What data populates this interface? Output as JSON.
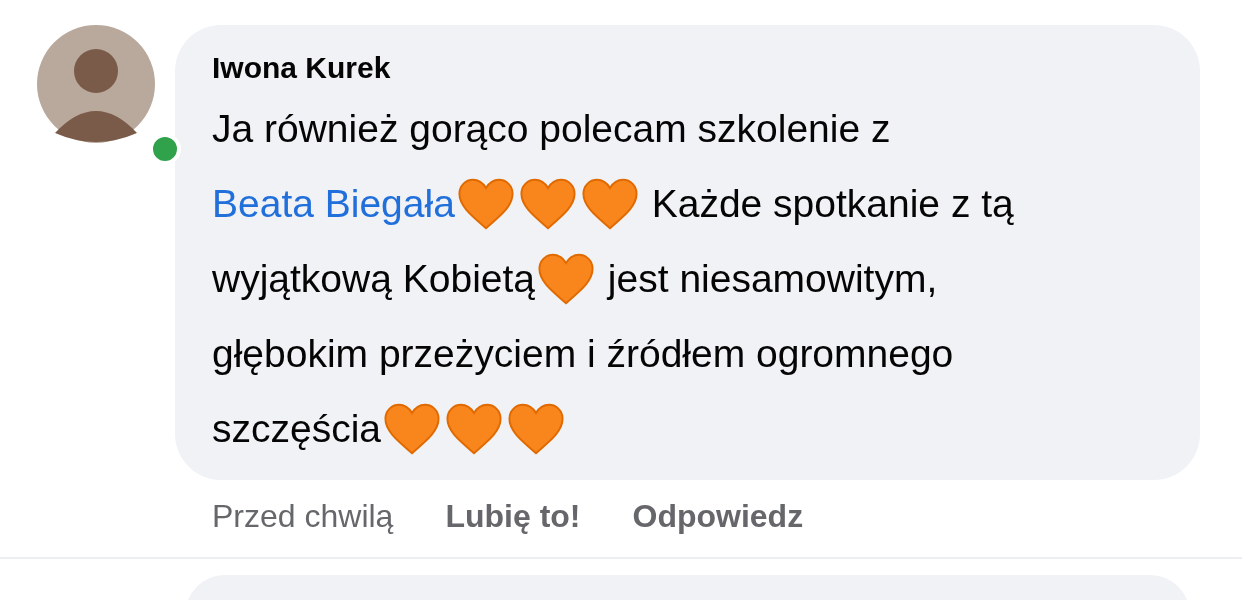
{
  "comment": {
    "author": {
      "name": "Iwona Kurek",
      "online": true
    },
    "lines": [
      [
        {
          "kind": "text",
          "text": "Ja również gorąco polecam szkolenie z"
        }
      ],
      [
        {
          "kind": "link",
          "text": "Beata Biegała"
        },
        {
          "kind": "heart"
        },
        {
          "kind": "heart"
        },
        {
          "kind": "heart"
        },
        {
          "kind": "text",
          "text": " Każde spotkanie z tą"
        }
      ],
      [
        {
          "kind": "text",
          "text": "wyjątkową Kobietą"
        },
        {
          "kind": "heart"
        },
        {
          "kind": "text",
          "text": " jest niesamowitym,"
        }
      ],
      [
        {
          "kind": "text",
          "text": "głębokim przeżyciem i źródłem ogromnego"
        }
      ],
      [
        {
          "kind": "text",
          "text": "szczęścia"
        },
        {
          "kind": "heart"
        },
        {
          "kind": "heart"
        },
        {
          "kind": "heart"
        }
      ]
    ],
    "time": "Przed chwilą",
    "actions": [
      "Lubię to!",
      "Odpowiedz"
    ]
  }
}
